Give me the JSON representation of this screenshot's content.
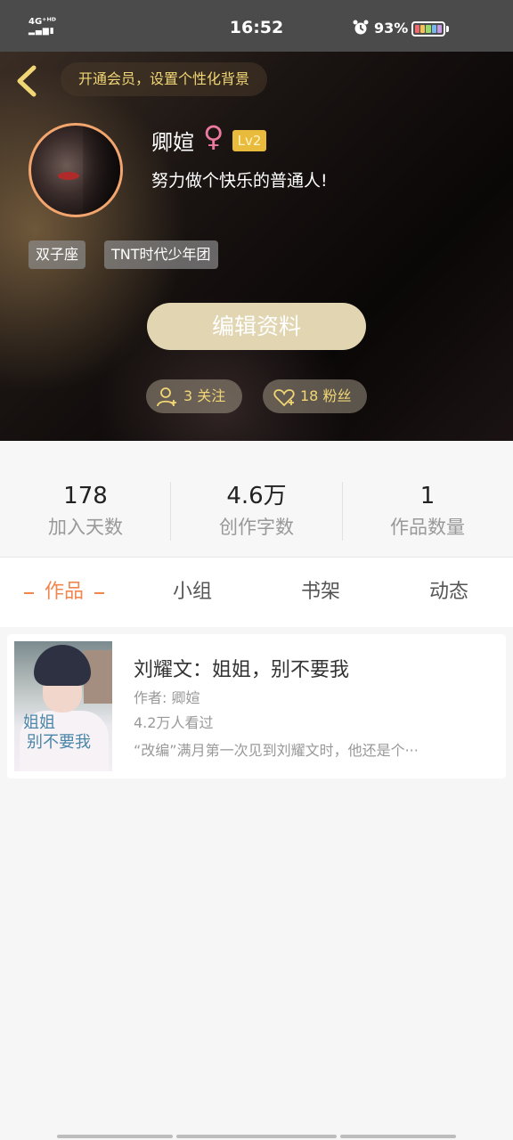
{
  "status_bar": {
    "network": "4G⁺ᴴᴰ",
    "time": "16:52",
    "battery_percent": "93%",
    "battery_level": 0.93,
    "icons": [
      "signal-icon",
      "alarm-icon",
      "battery-icon"
    ]
  },
  "header": {
    "vip_banner": "开通会员，设置个性化背景",
    "nickname": "卿媗",
    "gender_symbol": "♀",
    "level": "Lv2",
    "signature": "努力做个快乐的普通人!",
    "tags": [
      "双子座",
      "TNT时代少年团"
    ],
    "edit_button": "编辑资料",
    "following": "3 关注",
    "followers": "18 粉丝"
  },
  "stats": [
    {
      "value": "178",
      "label": "加入天数"
    },
    {
      "value": "4.6万",
      "label": "创作字数"
    },
    {
      "value": "1",
      "label": "作品数量"
    }
  ],
  "tabs": [
    "作品",
    "小组",
    "书架",
    "动态"
  ],
  "active_tab": "作品",
  "works": [
    {
      "title": "刘耀文：姐姐，别不要我",
      "author": "作者: 卿媗",
      "views": "4.2万人看过",
      "description": "“改编”满月第一次见到刘耀文时，他还是个···",
      "cover_text_line1": "姐姐",
      "cover_text_line2": "别不要我"
    }
  ],
  "colors": {
    "accent_orange": "#f0874f",
    "gold": "#f1d675",
    "edit_button": "#e1d5b2",
    "level_badge": "#e9bb3c",
    "female_pink": "#ec7aa0"
  }
}
